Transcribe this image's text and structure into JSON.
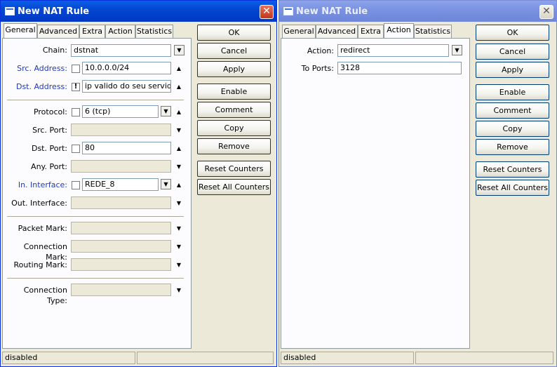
{
  "left_window": {
    "title": "New NAT Rule",
    "tabs": [
      "General",
      "Advanced",
      "Extra",
      "Action",
      "Statistics"
    ],
    "active_tab": "General",
    "fields": {
      "chain_label": "Chain:",
      "chain_value": "dstnat",
      "src_address_label": "Src. Address:",
      "src_address_value": "10.0.0.0/24",
      "dst_address_label": "Dst. Address:",
      "dst_address_negation": "!",
      "dst_address_value": "ip valido do seu servidor",
      "protocol_label": "Protocol:",
      "protocol_value": "6 (tcp)",
      "src_port_label": "Src. Port:",
      "dst_port_label": "Dst. Port:",
      "dst_port_value": "80",
      "any_port_label": "Any. Port:",
      "in_interface_label": "In. Interface:",
      "in_interface_value": "REDE_8",
      "out_interface_label": "Out. Interface:",
      "packet_mark_label": "Packet Mark:",
      "connection_mark_label": "Connection Mark:",
      "routing_mark_label": "Routing Mark:",
      "connection_type_label": "Connection Type:"
    },
    "status": "disabled"
  },
  "right_window": {
    "title": "New NAT Rule",
    "tabs": [
      "General",
      "Advanced",
      "Extra",
      "Action",
      "Statistics"
    ],
    "active_tab": "Action",
    "fields": {
      "action_label": "Action:",
      "action_value": "redirect",
      "to_ports_label": "To Ports:",
      "to_ports_value": "3128"
    },
    "status": "disabled"
  },
  "buttons": {
    "ok": "OK",
    "cancel": "Cancel",
    "apply": "Apply",
    "enable": "Enable",
    "comment": "Comment",
    "copy": "Copy",
    "remove": "Remove",
    "reset_counters": "Reset Counters",
    "reset_all_counters": "Reset All Counters"
  },
  "icons": {
    "close": "close-icon",
    "dropdown": "dropdown-arrow-icon",
    "expand": "expand-arrow-icon",
    "collapse": "collapse-arrow-icon"
  }
}
